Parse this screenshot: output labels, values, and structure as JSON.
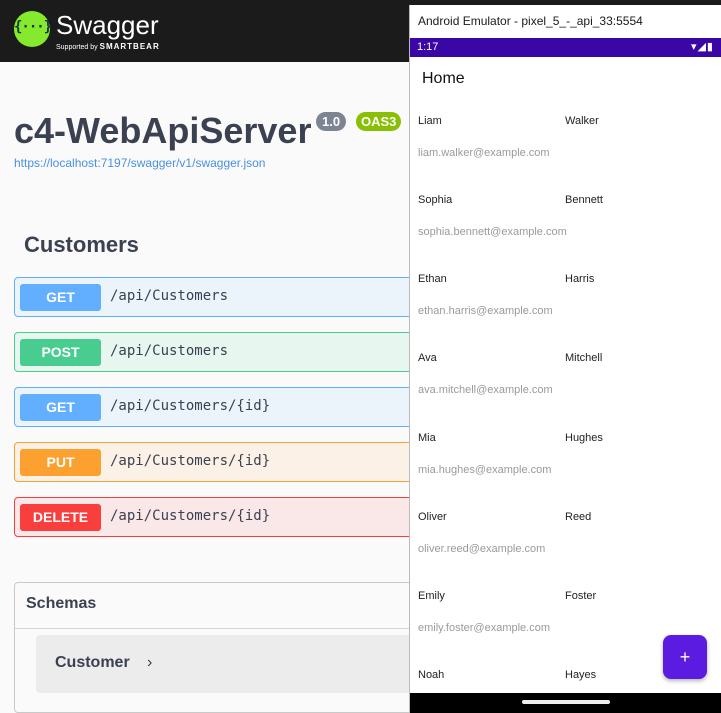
{
  "swagger": {
    "logo_text": "Swagger",
    "logo_sub_prefix": "Supported by",
    "logo_sub_brand": "SMARTBEAR",
    "logo_glyph": "{···}",
    "title": "c4-WebApiServer",
    "version": "1.0",
    "oas_badge": "OAS3",
    "spec_url": "https://localhost:7197/swagger/v1/swagger.json",
    "tag": "Customers",
    "operations": [
      {
        "method": "GET",
        "path": "/api/Customers",
        "kind": "get"
      },
      {
        "method": "POST",
        "path": "/api/Customers",
        "kind": "post"
      },
      {
        "method": "GET",
        "path": "/api/Customers/{id}",
        "kind": "get"
      },
      {
        "method": "PUT",
        "path": "/api/Customers/{id}",
        "kind": "put"
      },
      {
        "method": "DELETE",
        "path": "/api/Customers/{id}",
        "kind": "delete"
      }
    ],
    "schemas_title": "Schemas",
    "schema_items": [
      {
        "name": "Customer",
        "chevron": "›"
      }
    ],
    "colors": {
      "get": "#61affe",
      "post": "#49cc90",
      "put": "#fca130",
      "delete": "#f93e3e",
      "logo": "#85ea2d"
    }
  },
  "emulator": {
    "window_title": "Android Emulator - pixel_5_-_api_33:5554",
    "status_time": "1:17",
    "status_icons": "▾◢▮",
    "app_title": "Home",
    "customers": [
      {
        "first": "Liam",
        "last": "Walker",
        "email": "liam.walker@example.com"
      },
      {
        "first": "Sophia",
        "last": "Bennett",
        "email": "sophia.bennett@example.com"
      },
      {
        "first": "Ethan",
        "last": "Harris",
        "email": "ethan.harris@example.com"
      },
      {
        "first": "Ava",
        "last": "Mitchell",
        "email": "ava.mitchell@example.com"
      },
      {
        "first": "Mia",
        "last": "Hughes",
        "email": "mia.hughes@example.com"
      },
      {
        "first": "Oliver",
        "last": "Reed",
        "email": "oliver.reed@example.com"
      },
      {
        "first": "Emily",
        "last": "Foster",
        "email": "emily.foster@example.com"
      },
      {
        "first": "Noah",
        "last": "Hayes",
        "email": ""
      }
    ],
    "fab_label": "+",
    "colors": {
      "status_bar": "#3a06a5",
      "fab": "#5b1be0"
    }
  }
}
